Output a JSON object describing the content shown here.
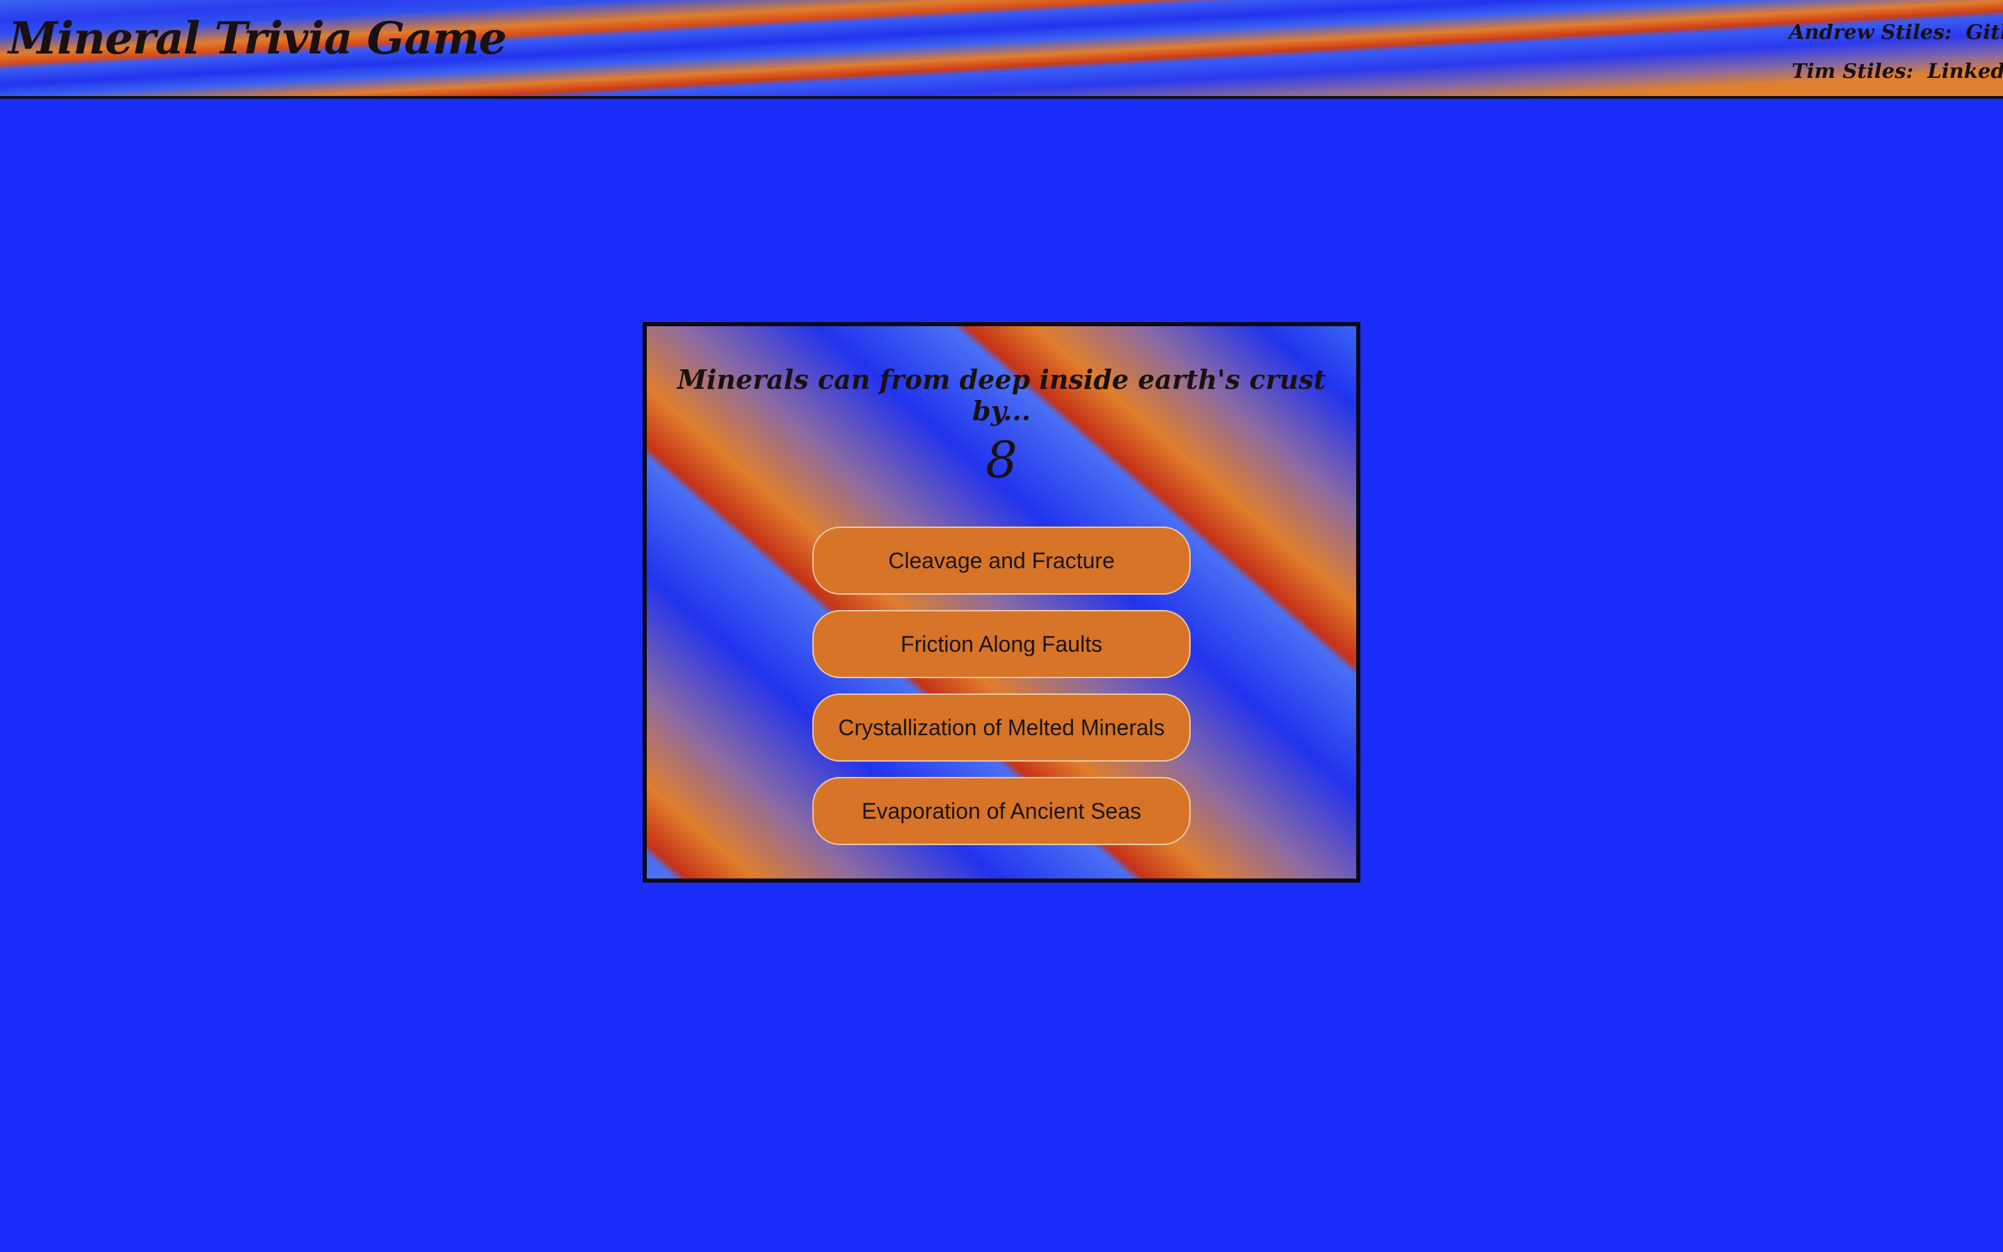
{
  "header": {
    "title": "Mineral Trivia Game",
    "credits": [
      {
        "name": "Andrew Stiles:",
        "link": "Github"
      },
      {
        "name": "Tim Stiles:",
        "link": "LinkedIn"
      }
    ]
  },
  "game": {
    "question": "Minerals can from deep inside earth's crust by...",
    "timer": "8",
    "answers": [
      "Cleavage and Fracture",
      "Friction Along Faults",
      "Crystallization of Melted Minerals",
      "Evaporation of Ancient Seas"
    ]
  },
  "colors": {
    "background": "#1c2cf8",
    "answer_button": "#d77428",
    "text": "#1a1010"
  }
}
